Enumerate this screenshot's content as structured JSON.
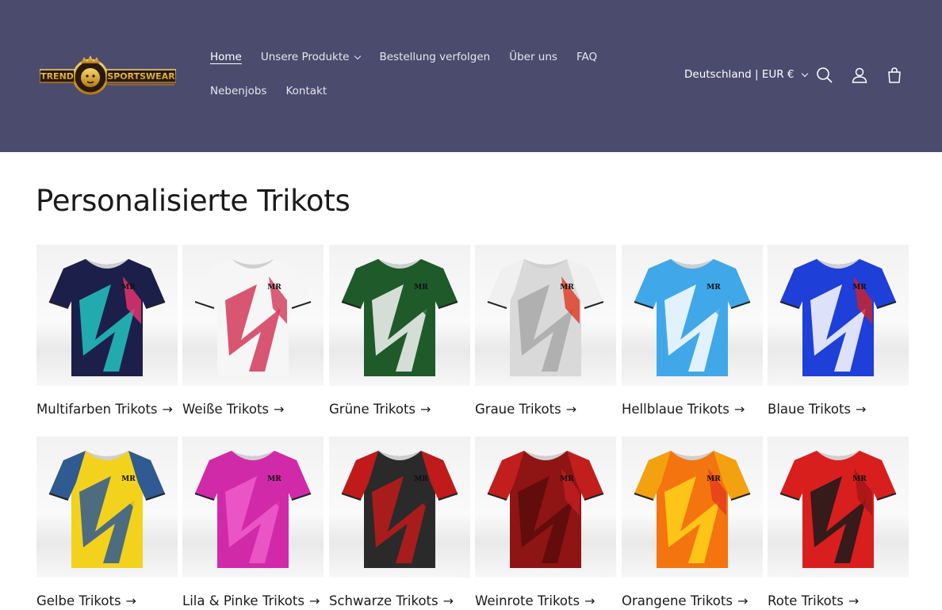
{
  "brand": {
    "logo_text_left": "TREND",
    "logo_text_right": "SPORTSWEAR",
    "accent": "#d4a020"
  },
  "header": {
    "background": "#4b4b6e",
    "nav_row1": [
      {
        "label": "Home",
        "active": true
      },
      {
        "label": "Unsere Produkte",
        "dropdown": true
      },
      {
        "label": "Bestellung verfolgen"
      },
      {
        "label": "Über uns"
      },
      {
        "label": "FAQ"
      }
    ],
    "nav_row2": [
      {
        "label": "Nebenjobs"
      },
      {
        "label": "Kontakt"
      }
    ],
    "locale": "Deutschland | EUR €",
    "icons": [
      "search-icon",
      "account-icon",
      "cart-icon"
    ]
  },
  "main": {
    "title": "Personalisierte Trikots",
    "collections": [
      {
        "label": "Multifarben Trikots",
        "body": "#1c1f4a",
        "sleeve": "#1c1f4a",
        "accent": "#23c4c0",
        "accent2": "#f0336e"
      },
      {
        "label": "Weiße Trikots",
        "body": "#f6f6f6",
        "sleeve": "#f6f6f6",
        "accent": "#d23a5a",
        "accent2": "#d23a5a"
      },
      {
        "label": "Grüne Trikots",
        "body": "#1e5a2a",
        "sleeve": "#1e5a2a",
        "accent": "#f5f5f5",
        "accent2": "#1e5a2a"
      },
      {
        "label": "Graue Trikots",
        "body": "#d9d9d9",
        "sleeve": "#f0f0f0",
        "accent": "#a8a8a8",
        "accent2": "#e0341f"
      },
      {
        "label": "Hellblaue Trikots",
        "body": "#40a8e8",
        "sleeve": "#40a8e8",
        "accent": "#ffffff",
        "accent2": "#40a8e8"
      },
      {
        "label": "Blaue Trikots",
        "body": "#1f3fd9",
        "sleeve": "#1f3fd9",
        "accent": "#ffffff",
        "accent2": "#d42020"
      },
      {
        "label": "Gelbe Trikots",
        "body": "#f3d21d",
        "sleeve": "#2f5a92",
        "accent": "#2f5a92",
        "accent2": "#f3d21d"
      },
      {
        "label": "Lila & Pinke Trikots",
        "body": "#d12aa9",
        "sleeve": "#d12aa9",
        "accent": "#ee5cc9",
        "accent2": "#d12aa9"
      },
      {
        "label": "Schwarze Trikots",
        "body": "#2a2a2a",
        "sleeve": "#c01a1a",
        "accent": "#c01a1a",
        "accent2": "#2a2a2a"
      },
      {
        "label": "Weinrote Trikots",
        "body": "#8f1414",
        "sleeve": "#c21e1e",
        "accent": "#5c0b0b",
        "accent2": "#c21e1e"
      },
      {
        "label": "Orangene Trikots",
        "body": "#f4740f",
        "sleeve": "#f4a10f",
        "accent": "#ffd21a",
        "accent2": "#e43b1a"
      },
      {
        "label": "Rote Trikots",
        "body": "#d91e1e",
        "sleeve": "#d91e1e",
        "accent": "#1a1a1a",
        "accent2": "#a31515"
      }
    ]
  }
}
